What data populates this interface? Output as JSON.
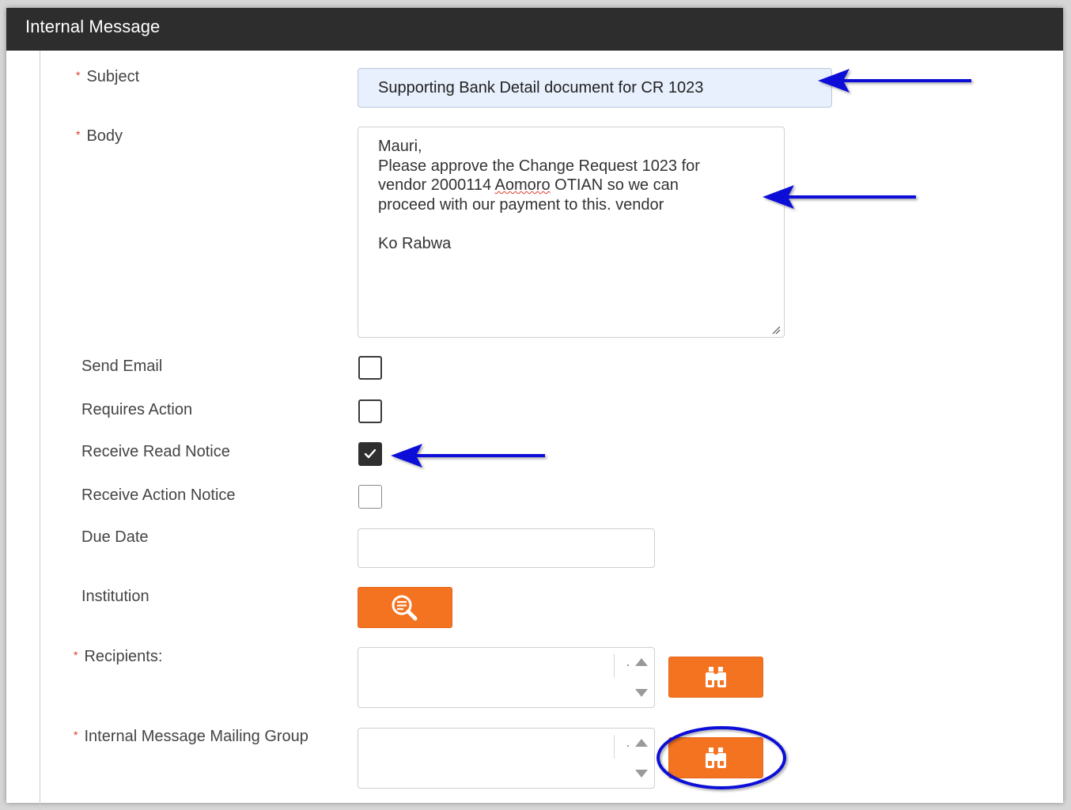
{
  "header": {
    "title": "Internal Message"
  },
  "fields": {
    "subject": {
      "label": "Subject",
      "value": "Supporting Bank Detail document for CR 1023"
    },
    "body": {
      "label": "Body",
      "lines": [
        "Mauri,",
        "Please approve the Change Request 1023 for",
        "vendor 2000114 ",
        "Aomoro",
        " OTIAN so we can",
        "proceed with our payment to this. vendor",
        "",
        "Ko Rabwa"
      ]
    },
    "send_email": {
      "label": "Send Email",
      "checked": false
    },
    "requires_action": {
      "label": "Requires Action",
      "checked": false
    },
    "receive_read_notice": {
      "label": "Receive Read Notice",
      "checked": true
    },
    "receive_action_notice": {
      "label": "Receive Action Notice",
      "checked": false
    },
    "due_date": {
      "label": "Due Date",
      "value": ""
    },
    "institution": {
      "label": "Institution",
      "button_icon": "search-document-icon"
    },
    "recipients": {
      "label": "Recipients:",
      "value": "",
      "button_icon": "binoculars-icon"
    },
    "mailing_group": {
      "label": "Internal Message Mailing Group",
      "value": "",
      "button_icon": "binoculars-icon"
    }
  },
  "colors": {
    "header_bg": "#2d2d2d",
    "accent_orange": "#f47321",
    "required_star": "#e0392b",
    "annotation_blue": "#0a10d8",
    "subject_fill": "#e8f0fd"
  }
}
